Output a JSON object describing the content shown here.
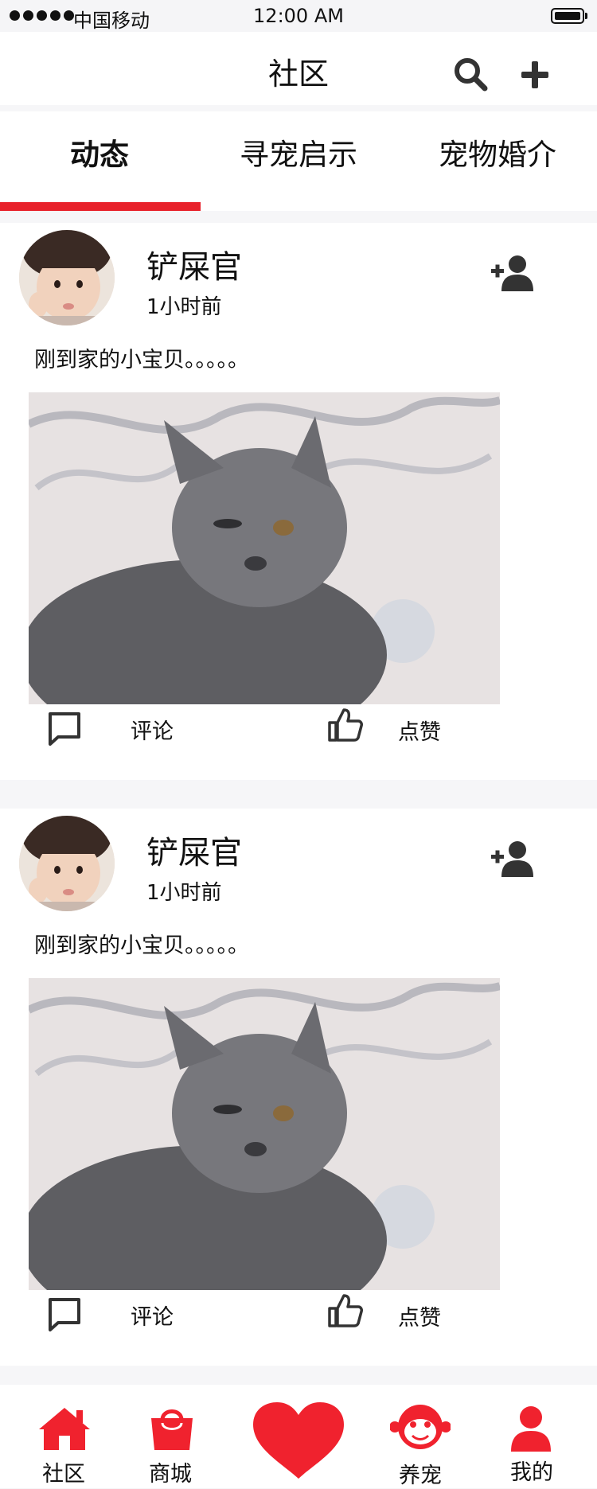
{
  "status_bar": {
    "carrier": "中国移动",
    "time": "12:00 AM"
  },
  "header": {
    "title": "社区",
    "icons": [
      "search-icon",
      "add-icon"
    ]
  },
  "tabs": [
    {
      "label": "动态",
      "active": true
    },
    {
      "label": "寻宠启示",
      "active": false
    },
    {
      "label": "宠物婚介",
      "active": false
    }
  ],
  "posts": [
    {
      "username": "铲屎官",
      "time": "1小时前",
      "caption": "刚到家的小宝贝。。。。。",
      "comment_label": "评论",
      "like_label": "点赞"
    },
    {
      "username": "铲屎官",
      "time": "1小时前",
      "caption": "刚到家的小宝贝。。。。。",
      "comment_label": "评论",
      "like_label": "点赞"
    }
  ],
  "tabbar": [
    {
      "label": "社区",
      "icon": "home-icon"
    },
    {
      "label": "商城",
      "icon": "shopping-bag-icon"
    },
    {
      "label": "",
      "icon": "heart-icon"
    },
    {
      "label": "养宠",
      "icon": "monkey-face-icon"
    },
    {
      "label": "我的",
      "icon": "person-icon"
    }
  ],
  "colors": {
    "accent": "#e8212b",
    "icon_dark": "#333333",
    "tabbar_red": "#f0222e"
  }
}
